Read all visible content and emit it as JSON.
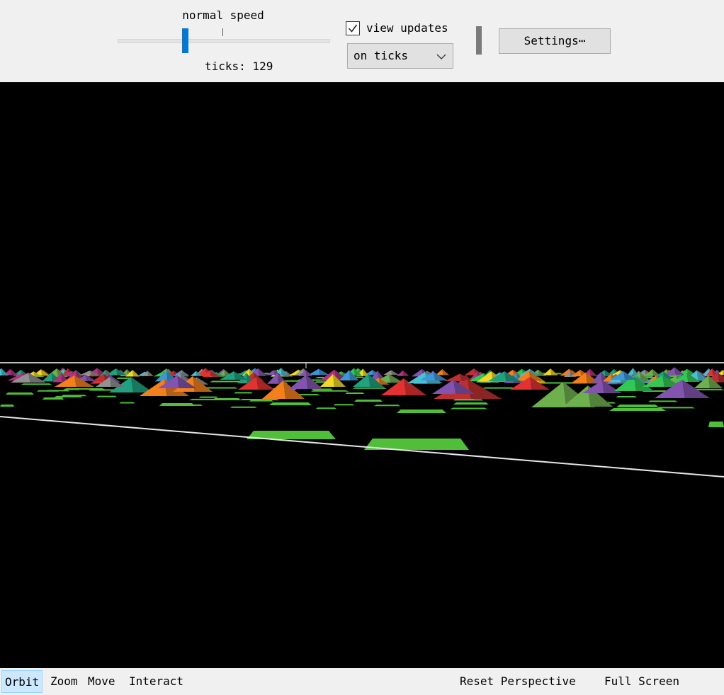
{
  "toolbar": {
    "speed_label": "normal speed",
    "speed_level": 0.32,
    "ticks_label": "ticks: 129",
    "view_updates": {
      "label": "view updates",
      "checked": true
    },
    "update_mode": {
      "selected": "on ticks"
    },
    "settings_label": "Settings⋯"
  },
  "viewport": {
    "description_free": true,
    "world_colors": [
      "#1e9a7a",
      "#e87a1a",
      "#7d4fa8",
      "#d93030",
      "#6aa84a",
      "#8a8a8a",
      "#e6d020",
      "#3a8fd0",
      "#2fbf4f",
      "#a8307a",
      "#b52e2e",
      "#46b8c8"
    ],
    "patch_color": "#4fbf3a"
  },
  "bottombar": {
    "orbit": "Orbit",
    "zoom": "Zoom",
    "move": "Move",
    "interact": "Interact",
    "reset": "Reset Perspective",
    "fullscreen": "Full Screen"
  },
  "icons": {
    "checkbox": "checkmark-icon",
    "dropdown": "chevron-down-icon"
  }
}
